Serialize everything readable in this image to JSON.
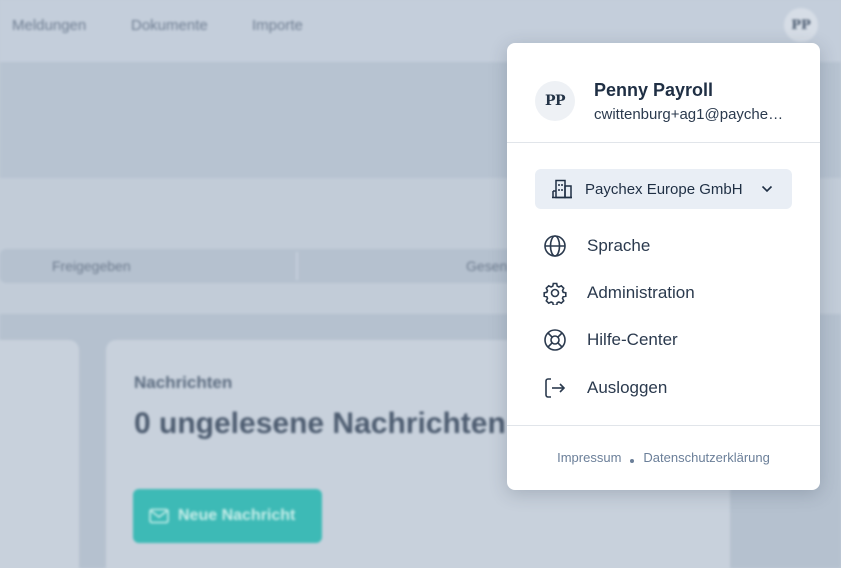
{
  "nav": {
    "items": [
      "Meldungen",
      "Dokumente",
      "Importe"
    ],
    "avatar_initials": "PP"
  },
  "filters": {
    "segments": [
      "Freigegeben",
      "Gesen"
    ]
  },
  "messages_card": {
    "kicker": "Nachrichten",
    "title": "0 ungelesene Nachrichten",
    "button_label": "Neue Nachricht"
  },
  "menu": {
    "avatar_initials": "PP",
    "name": "Penny Payroll",
    "email": "cwittenburg+ag1@payche…",
    "company": "Paychex Europe GmbH",
    "items": [
      {
        "label": "Sprache",
        "icon": "globe-icon"
      },
      {
        "label": "Administration",
        "icon": "gear-icon"
      },
      {
        "label": "Hilfe-Center",
        "icon": "lifebuoy-icon"
      },
      {
        "label": "Ausloggen",
        "icon": "logout-icon"
      }
    ],
    "footer": {
      "impressum": "Impressum",
      "privacy": "Datenschutzerklärung"
    }
  },
  "colors": {
    "accent_button": "#3dbab6",
    "overlay": "#c2ccd8",
    "menu_bg": "#ffffff"
  }
}
